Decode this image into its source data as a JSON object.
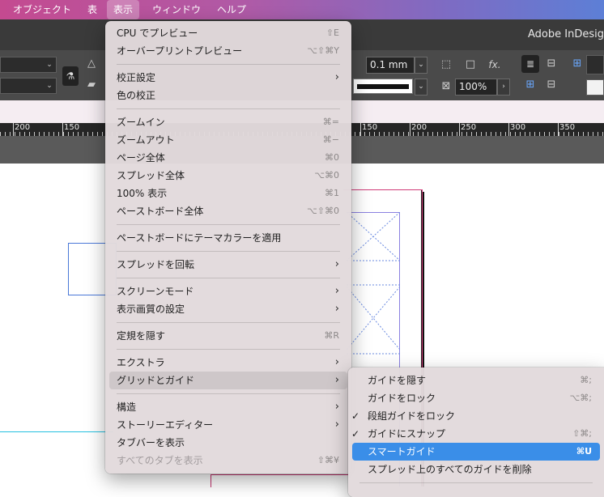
{
  "menubar": {
    "items": [
      "オブジェクト",
      "表",
      "表示",
      "ウィンドウ",
      "ヘルプ"
    ]
  },
  "app": {
    "title": "Adobe InDesig"
  },
  "controls": {
    "stroke_weight": "0.1 mm",
    "scale": "100%"
  },
  "ruler": {
    "labels": [
      "200",
      "150",
      "150",
      "200",
      "250",
      "300",
      "350"
    ]
  },
  "view_menu": {
    "items": [
      {
        "label": "CPU でプレビュー",
        "shortcut": "⇧E"
      },
      {
        "label": "オーバープリントプレビュー",
        "shortcut": "⌥⇧⌘Y"
      },
      {
        "label": "校正設定"
      },
      {
        "label": "色の校正"
      },
      {
        "label": "ズームイン",
        "shortcut": "⌘="
      },
      {
        "label": "ズームアウト",
        "shortcut": "⌘−"
      },
      {
        "label": "ページ全体",
        "shortcut": "⌘0"
      },
      {
        "label": "スプレッド全体",
        "shortcut": "⌥⌘0"
      },
      {
        "label": "100% 表示",
        "shortcut": "⌘1"
      },
      {
        "label": "ペーストボード全体",
        "shortcut": "⌥⇧⌘0"
      },
      {
        "label": "ペーストボードにテーマカラーを適用"
      },
      {
        "label": "スプレッドを回転"
      },
      {
        "label": "スクリーンモード"
      },
      {
        "label": "表示画質の設定"
      },
      {
        "label": "定規を隠す",
        "shortcut": "⌘R"
      },
      {
        "label": "エクストラ"
      },
      {
        "label": "グリッドとガイド"
      },
      {
        "label": "構造"
      },
      {
        "label": "ストーリーエディター"
      },
      {
        "label": "タブバーを表示"
      },
      {
        "label": "すべてのタブを表示",
        "shortcut": "⇧⌘¥"
      }
    ]
  },
  "grid_submenu": {
    "items": [
      {
        "label": "ガイドを隠す",
        "shortcut": "⌘;"
      },
      {
        "label": "ガイドをロック",
        "shortcut": "⌥⌘;"
      },
      {
        "label": "段組ガイドをロック",
        "checked": "✓"
      },
      {
        "label": "ガイドにスナップ",
        "shortcut": "⇧⌘;",
        "checked": "✓"
      },
      {
        "label": "スマートガイド",
        "shortcut": "⌘U"
      },
      {
        "label": "スプレッド上のすべてのガイドを削除"
      }
    ]
  },
  "colors": {
    "accent": "#3a8ee8",
    "menubar_start": "#c44a90",
    "menubar_end": "#5d7fd6"
  }
}
